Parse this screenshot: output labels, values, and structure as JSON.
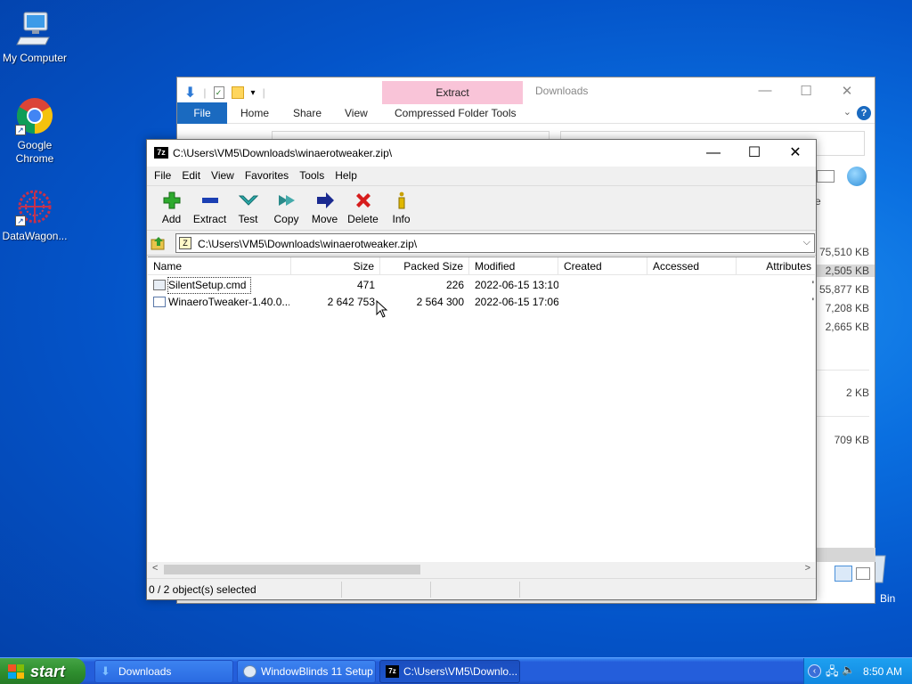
{
  "desktop": {
    "icons": [
      {
        "label": "My Computer"
      },
      {
        "label": "Google Chrome"
      },
      {
        "label": "DataWagon..."
      }
    ],
    "recycle_bin_partial": "Bin"
  },
  "explorer": {
    "ribbon_context_tab": "Extract",
    "title": "Downloads",
    "tabs": [
      "File",
      "Home",
      "Share",
      "View",
      "Compressed Folder Tools"
    ],
    "visible_sizes": [
      "75,510 KB",
      "2,505 KB",
      "55,877 KB",
      "7,208 KB",
      "2,665 KB",
      "2 KB",
      "709 KB"
    ],
    "partial_column": "e"
  },
  "sevenzip": {
    "title": "C:\\Users\\VM5\\Downloads\\winaerotweaker.zip\\",
    "menu": [
      "File",
      "Edit",
      "View",
      "Favorites",
      "Tools",
      "Help"
    ],
    "toolbar": [
      "Add",
      "Extract",
      "Test",
      "Copy",
      "Move",
      "Delete",
      "Info"
    ],
    "address": "C:\\Users\\VM5\\Downloads\\winaerotweaker.zip\\",
    "columns": [
      "Name",
      "Size",
      "Packed Size",
      "Modified",
      "Created",
      "Accessed",
      "Attributes"
    ],
    "files": [
      {
        "name": "SilentSetup.cmd",
        "size": "471",
        "packed": "226",
        "modified": "2022-06-15 13:10",
        "attr": "'"
      },
      {
        "name": "WinaeroTweaker-1.40.0....",
        "size": "2 642 753",
        "packed": "2 564 300",
        "modified": "2022-06-15 17:06",
        "attr": "'"
      }
    ],
    "status": "0 / 2 object(s) selected",
    "accent_colors": {
      "add": "#2eaa2e",
      "extract": "#1b3fb3",
      "test": "#2aa8a8",
      "copy": "#2a8a8a",
      "move": "#1a2a90",
      "delete": "#d61c1c",
      "info": "#c8a000"
    }
  },
  "taskbar": {
    "start_label": "start",
    "tasks": [
      "Downloads",
      "WindowBlinds 11 Setup",
      "C:\\Users\\VM5\\Downlo..."
    ],
    "clock": "8:50 AM"
  }
}
